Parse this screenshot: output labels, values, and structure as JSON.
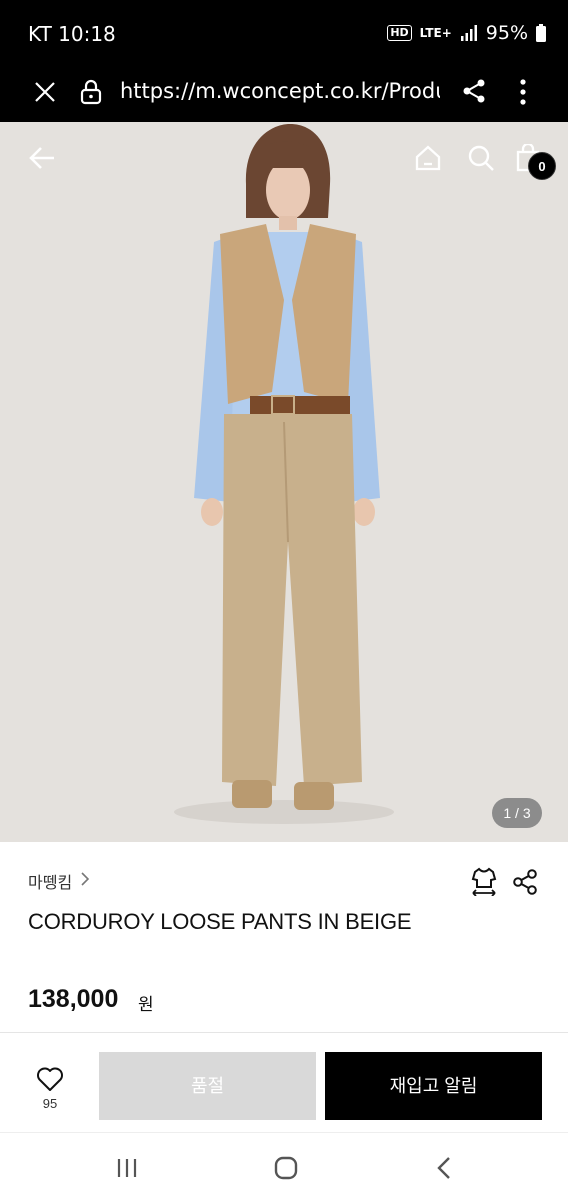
{
  "status_bar": {
    "carrier_time": "KT 10:18",
    "hd": "HD",
    "network": "LTE+",
    "battery": "95%"
  },
  "browser": {
    "url": "https://m.wconcept.co.kr/Product"
  },
  "header": {
    "cart_count": "0"
  },
  "gallery": {
    "page_indicator": "1 / 3"
  },
  "product": {
    "brand": "마뗑킴",
    "title": "CORDUROY LOOSE PANTS IN BEIGE",
    "price": "138,000",
    "price_unit": "원"
  },
  "actions": {
    "like_count": "95",
    "soldout_label": "품절",
    "restock_label": "재입고 알림"
  }
}
